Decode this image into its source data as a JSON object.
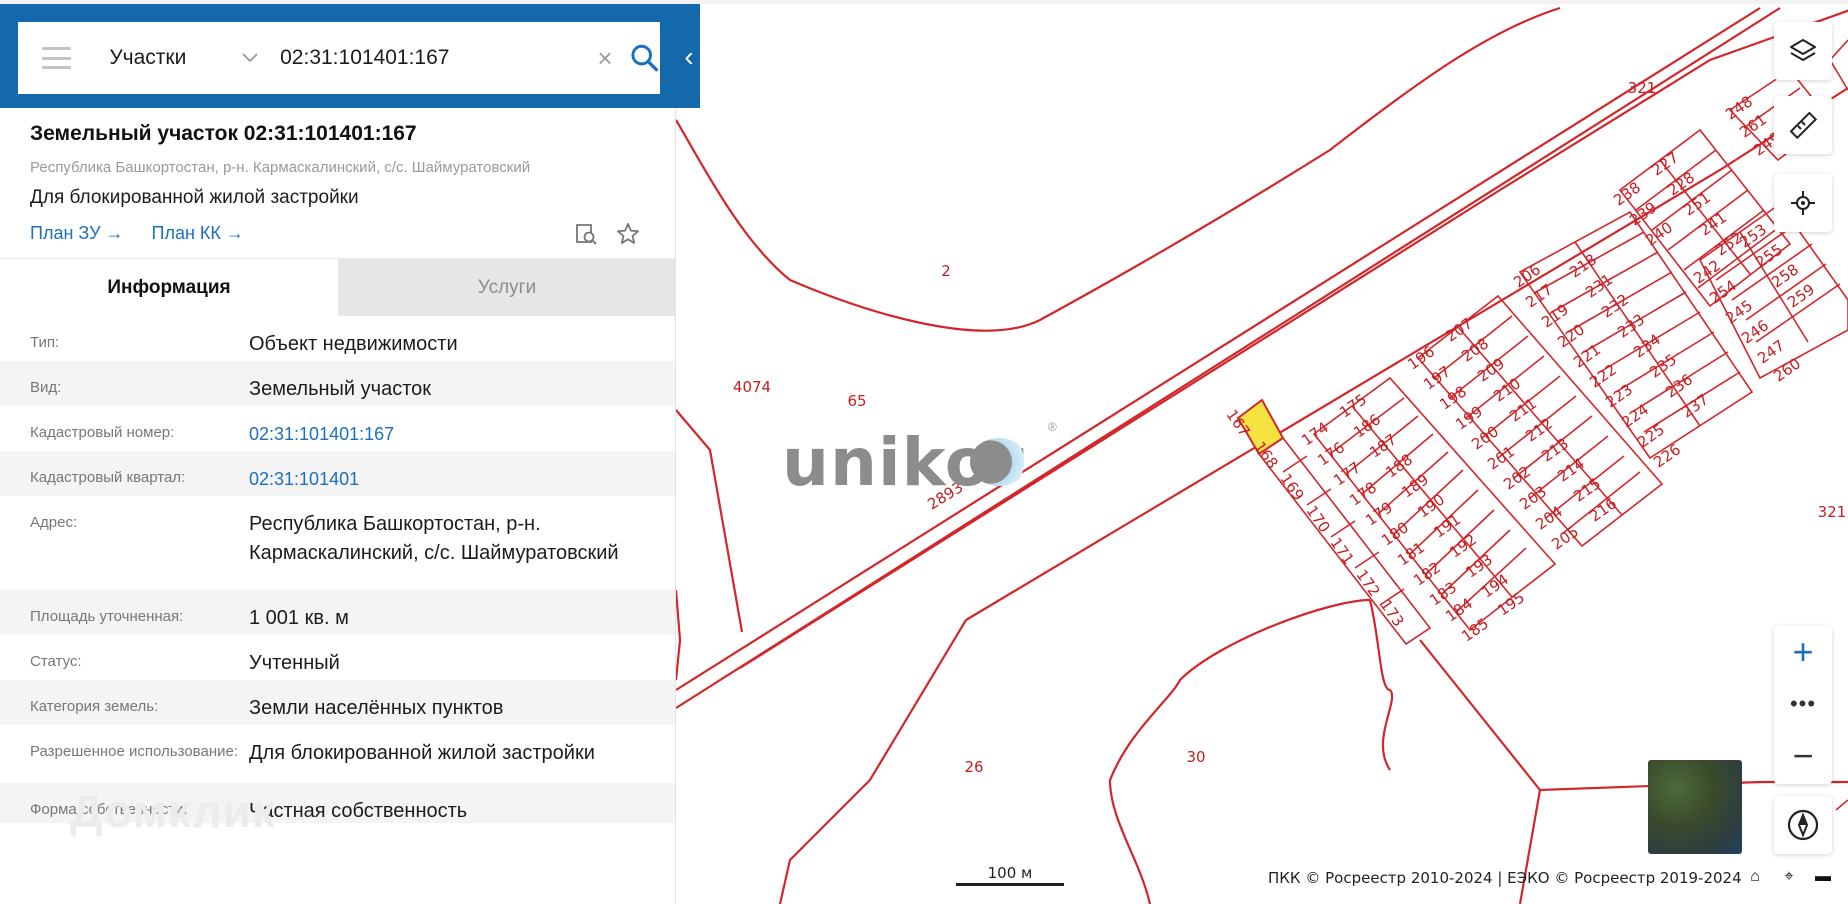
{
  "search": {
    "type": "Участки",
    "query": "02:31:101401:167"
  },
  "parcel": {
    "title": "Земельный участок 02:31:101401:167",
    "address": "Республика Башкортостан, р-н. Кармаскалинский, с/с. Шаймуратовский",
    "purpose": "Для блокированной жилой застройки",
    "links": [
      "План ЗУ →",
      "План КК →"
    ]
  },
  "tabs": [
    "Информация",
    "Услуги"
  ],
  "info": [
    {
      "k": "Тип:",
      "v": "Объект недвижимости"
    },
    {
      "k": "Вид:",
      "v": "Земельный участок"
    },
    {
      "k": "Кадастровый номер:",
      "v": "02:31:101401:167"
    },
    {
      "k": "Кадастровый квартал:",
      "v": "02:31:101401"
    },
    {
      "k": "Адрес:",
      "v": "Республика Башкортостан, р-н. Кармаскалинский, с/с. Шаймуратовский"
    },
    {
      "k": "Площадь уточненная:",
      "v": "1 001 кв. м"
    },
    {
      "k": "Статус:",
      "v": "Учтенный"
    },
    {
      "k": "Категория земель:",
      "v": "Земли населённых пунктов"
    },
    {
      "k": "Разрешенное использование:",
      "v": "Для блокированной жилой застройки"
    },
    {
      "k": "Форма собственности:",
      "v": "Частная собственность"
    }
  ],
  "watermarks": {
    "domclick": "Домклик",
    "unikor": "unikor"
  },
  "map": {
    "labels": [
      "2",
      "4074",
      "65",
      "2893",
      "26",
      "30",
      "321",
      "321",
      "167",
      "168",
      "169",
      "170",
      "171",
      "172",
      "173",
      "174",
      "175",
      "176",
      "186",
      "177",
      "187",
      "178",
      "188",
      "179",
      "189",
      "180",
      "190",
      "181",
      "191",
      "182",
      "192",
      "183",
      "193",
      "184",
      "194",
      "185",
      "195",
      "196",
      "207",
      "197",
      "208",
      "198",
      "209",
      "199",
      "210",
      "200",
      "211",
      "201",
      "212",
      "202",
      "213",
      "203",
      "214",
      "204",
      "215",
      "205",
      "216",
      "206",
      "217",
      "218",
      "219",
      "231",
      "220",
      "232",
      "221",
      "233",
      "222",
      "234",
      "223",
      "235",
      "224",
      "236",
      "225",
      "237",
      "226",
      "238",
      "227",
      "239",
      "228",
      "240",
      "251",
      "241",
      "252",
      "242",
      "253",
      "254",
      "255",
      "245",
      "258",
      "246",
      "259",
      "247",
      "260",
      "248",
      "261",
      "249",
      "250",
      "262",
      "263",
      "264"
    ],
    "scale": "100 м",
    "attribution": "ПКК © Росреестр 2010-2024 | ЕЭКО © Росреестр 2019-2024",
    "highlight_color": "#f5e342",
    "boundary_color": "#d2262b"
  },
  "controls": {
    "zoom_in": "+",
    "more": "•••",
    "zoom_out": "−"
  }
}
